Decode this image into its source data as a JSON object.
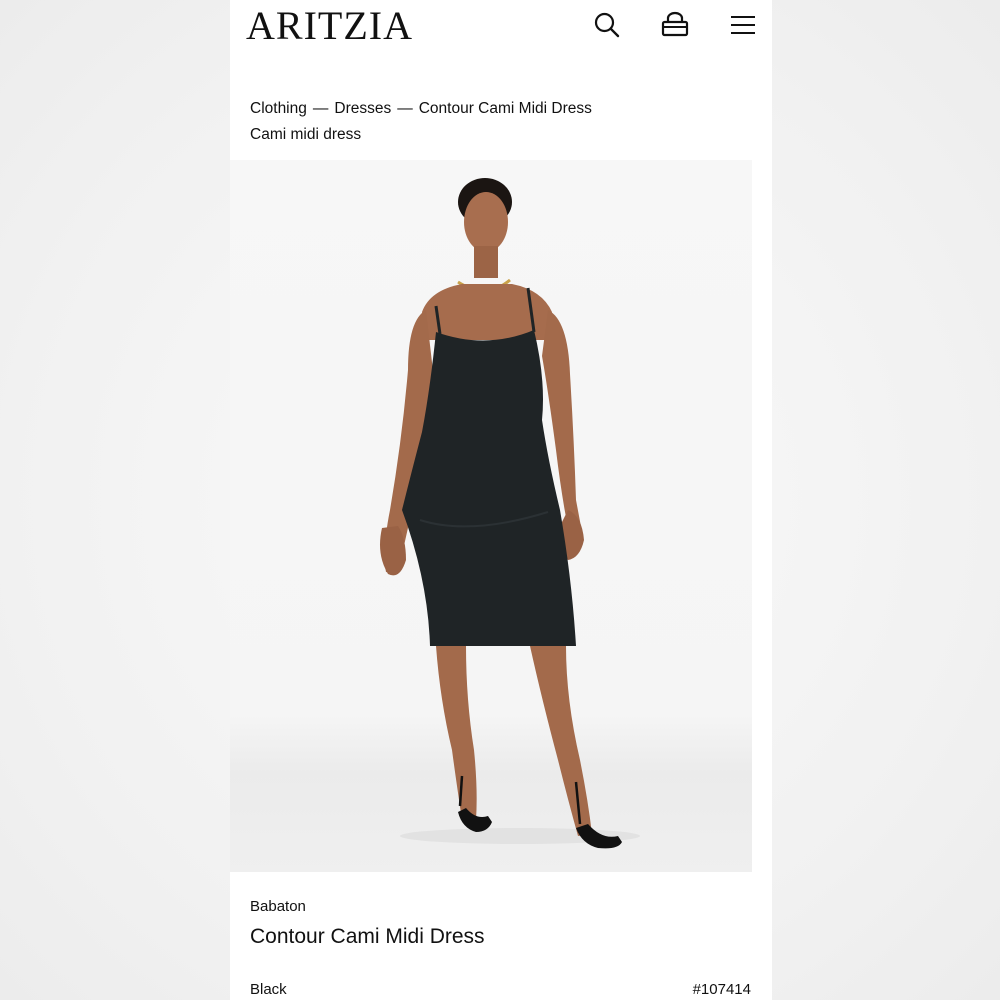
{
  "header": {
    "logo": "ARITZIA",
    "icons": [
      "search-icon",
      "bag-icon",
      "menu-icon"
    ]
  },
  "breadcrumb": {
    "items": [
      "Clothing",
      "Dresses",
      "Contour Cami Midi Dress"
    ],
    "separator": "—"
  },
  "subtitle": "Cami midi dress",
  "product": {
    "brand": "Babaton",
    "name": "Contour Cami Midi Dress",
    "color": "Black",
    "sku": "#107414"
  },
  "colors": {
    "text": "#111111",
    "background": "#ffffff",
    "dress": "#1f2426"
  }
}
